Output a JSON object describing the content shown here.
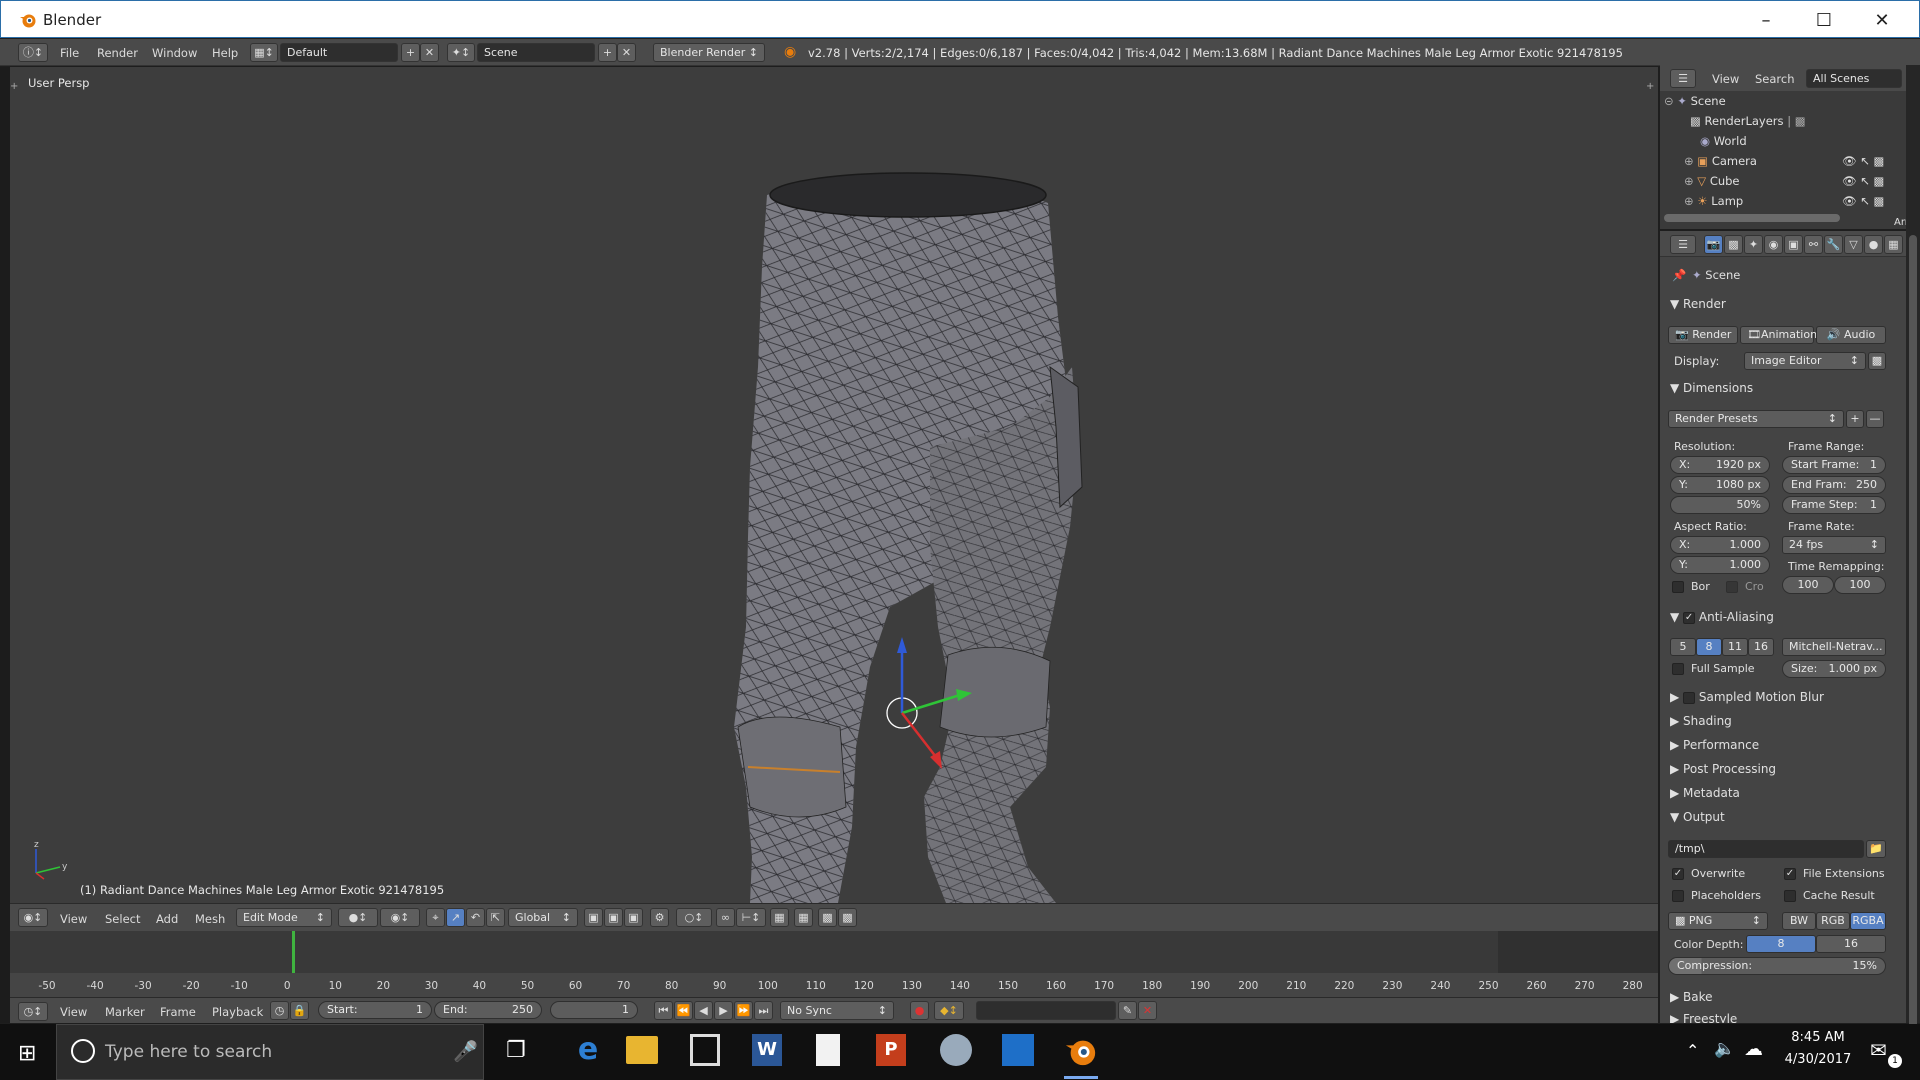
{
  "window": {
    "title": "Blender"
  },
  "menubar": {
    "items": [
      "File",
      "Render",
      "Window",
      "Help"
    ],
    "layout": "Default",
    "scene": "Scene",
    "engine": "Blender Render",
    "stats": "v2.78 | Verts:2/2,174 | Edges:0/6,187 | Faces:0/4,042 | Tris:4,042 | Mem:13.68M | Radiant Dance Machines Male Leg Armor Exotic 921478195"
  },
  "viewport": {
    "view_name": "User Persp",
    "object_label": "(1) Radiant Dance Machines Male Leg Armor Exotic 921478195",
    "mesh_color": "#7c7c84"
  },
  "view3d_header": {
    "items": [
      "View",
      "Select",
      "Add",
      "Mesh"
    ],
    "mode": "Edit Mode",
    "orientation": "Global"
  },
  "timeline": {
    "ticks": [
      "-50",
      "-40",
      "-30",
      "-20",
      "-10",
      "0",
      "10",
      "20",
      "30",
      "40",
      "50",
      "60",
      "70",
      "80",
      "90",
      "100",
      "110",
      "120",
      "130",
      "140",
      "150",
      "160",
      "170",
      "180",
      "190",
      "200",
      "210",
      "220",
      "230",
      "240",
      "250",
      "260",
      "270",
      "280"
    ],
    "menu": [
      "View",
      "Marker",
      "Frame",
      "Playback"
    ],
    "start_label": "Start:",
    "start": "1",
    "end_label": "End:",
    "end": "250",
    "current": "1",
    "sync": "No Sync"
  },
  "outliner": {
    "menu": [
      "View",
      "Search"
    ],
    "filter": "All Scenes",
    "items": [
      {
        "label": "Scene",
        "icon": "scene-icon"
      },
      {
        "label": "RenderLayers",
        "icon": "renderlayers-icon"
      },
      {
        "label": "World",
        "icon": "world-icon"
      },
      {
        "label": "Camera",
        "icon": "camera-icon"
      },
      {
        "label": "Cube",
        "icon": "mesh-icon"
      },
      {
        "label": "Lamp",
        "icon": "lamp-icon"
      }
    ],
    "side_label": "Arr"
  },
  "properties": {
    "context": "Scene",
    "render_section": "Render",
    "render_btn": "Render",
    "animation_btn": "Animation",
    "audio_btn": "Audio",
    "display_label": "Display:",
    "display_value": "Image Editor",
    "dimensions": "Dimensions",
    "render_presets": "Render Presets",
    "resolution_label": "Resolution:",
    "res_x": "X:",
    "res_x_val": "1920 px",
    "res_y": "Y:",
    "res_y_val": "1080 px",
    "res_pct": "50%",
    "frame_range_label": "Frame Range:",
    "start_frame": "Start Frame:",
    "start_frame_val": "1",
    "end_frame": "End Fram:",
    "end_frame_val": "250",
    "frame_step": "Frame Step:",
    "frame_step_val": "1",
    "aspect_label": "Aspect Ratio:",
    "asp_x": "X:",
    "asp_x_val": "1.000",
    "asp_y": "Y:",
    "asp_y_val": "1.000",
    "frame_rate_label": "Frame Rate:",
    "fps": "24 fps",
    "time_remap_label": "Time Remapping:",
    "bor": "Bor",
    "cro": "Cro",
    "remap_old": "100",
    "remap_new": "100",
    "anti_aliasing": "Anti-Aliasing",
    "aa_samples": [
      "5",
      "8",
      "11",
      "16"
    ],
    "aa_selected": "8",
    "aa_filter": "Mitchell-Netrav...",
    "full_sample": "Full Sample",
    "size_label": "Size:",
    "size_val": "1.000 px",
    "sampled_motion_blur": "Sampled Motion Blur",
    "collapsed": [
      "Shading",
      "Performance",
      "Post Processing",
      "Metadata"
    ],
    "output": "Output",
    "output_path": "/tmp\\",
    "overwrite": "Overwrite",
    "file_extensions": "File Extensions",
    "placeholders": "Placeholders",
    "cache_result": "Cache Result",
    "format": "PNG",
    "color_modes": [
      "BW",
      "RGB",
      "RGBA"
    ],
    "color_mode_selected": "RGBA",
    "color_depth_label": "Color Depth:",
    "depth_8": "8",
    "depth_16": "16",
    "compression_label": "Compression:",
    "compression_val": "15%",
    "bake": "Bake",
    "freestyle": "Freestyle"
  },
  "taskbar": {
    "search_placeholder": "Type here to search",
    "time": "8:45 AM",
    "date": "4/30/2017",
    "notif_count": "1"
  },
  "colors": {
    "accent": "#5680c2",
    "viewport_bg": "#3d3d3d",
    "panel_bg": "#444444"
  }
}
